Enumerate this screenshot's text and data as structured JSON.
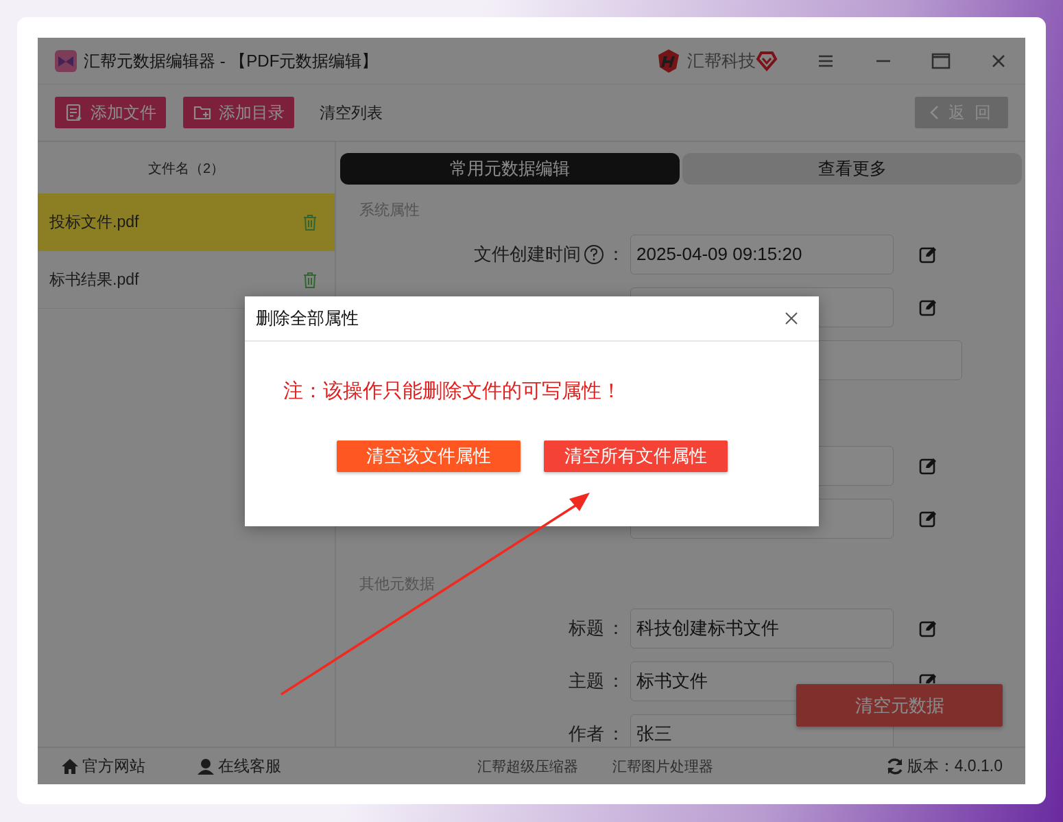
{
  "window": {
    "title": "汇帮元数据编辑器 - 【PDF元数据编辑】",
    "brand": "汇帮科技"
  },
  "toolbar": {
    "buttons": [
      {
        "label": "添加文件",
        "kind": "file"
      },
      {
        "label": "添加目录",
        "kind": "folder"
      }
    ],
    "clear_list": "清空列表",
    "back": "返 回"
  },
  "file_list": {
    "header": "文件名（2）",
    "files": [
      {
        "name": "投标文件.pdf",
        "selected": true
      },
      {
        "name": "标书结果.pdf",
        "selected": false
      }
    ]
  },
  "tabs": [
    {
      "label": "常用元数据编辑",
      "selected": true
    },
    {
      "label": "查看更多",
      "selected": false
    }
  ],
  "sections": [
    {
      "title": "系统属性",
      "fields": [
        {
          "kind": "help",
          "label": "文件创建时间",
          "colon": "：",
          "value": "2025-04-09 09:15:20"
        },
        {
          "kind": "help_hidden"
        },
        {
          "kind": "wide"
        },
        {
          "kind": "spaced"
        },
        {
          "kind": "plain"
        }
      ]
    },
    {
      "title": "其他元数据",
      "fields": [
        {
          "kind": "plain",
          "label": "标题",
          "colon": "：",
          "value": "科技创建标书文件"
        },
        {
          "kind": "plain",
          "label": "主题",
          "colon": "：",
          "value": "标书文件"
        },
        {
          "kind": "plain",
          "label": "作者",
          "colon": "：",
          "value": "张三"
        }
      ]
    }
  ],
  "clear_button": "清空元数据",
  "footer": {
    "links": [
      {
        "label": "官方网站",
        "kind": "home"
      },
      {
        "label": "在线客服",
        "kind": "service"
      }
    ],
    "apps": [
      "汇帮超级压缩器",
      "汇帮图片处理器"
    ],
    "version": "版本：4.0.1.0"
  },
  "dialog": {
    "title": "删除全部属性",
    "message": "注：该操作只能删除文件的可写属性！",
    "buttons": [
      {
        "label": "清空该文件属性",
        "color": "#ff5722"
      },
      {
        "label": "清空所有文件属性",
        "color": "#f44336"
      }
    ]
  }
}
